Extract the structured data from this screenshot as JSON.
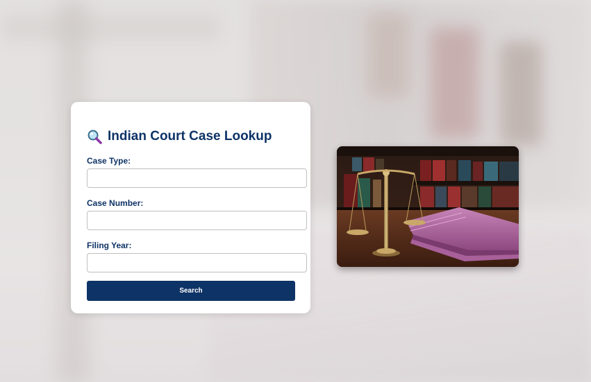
{
  "form": {
    "title": "Indian Court Case Lookup",
    "title_icon": "magnifying-glass-icon",
    "fields": [
      {
        "label": "Case Type:",
        "value": "",
        "placeholder": ""
      },
      {
        "label": "Case Number:",
        "value": "",
        "placeholder": ""
      },
      {
        "label": "Filing Year:",
        "value": "",
        "placeholder": ""
      }
    ],
    "submit_label": "Search"
  },
  "illustration": {
    "icon": "scales-of-justice-image"
  },
  "colors": {
    "accent": "#0e3366",
    "card_background": "#ffffff",
    "input_border": "#bfbfbf"
  }
}
